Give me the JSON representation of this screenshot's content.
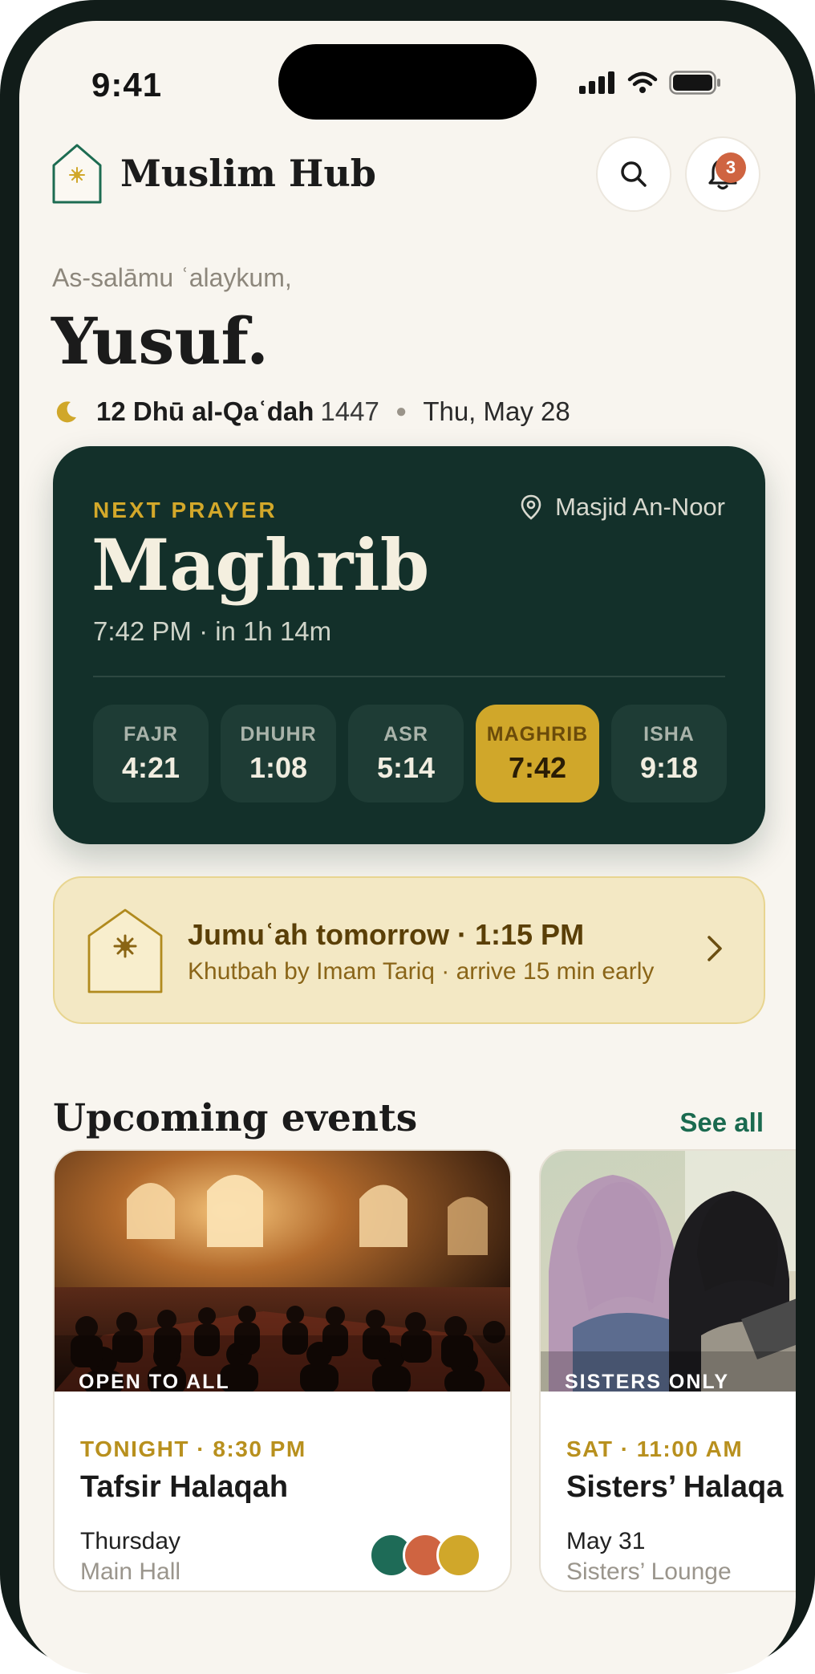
{
  "status_bar": {
    "time": "9:41"
  },
  "header": {
    "app_name": "Muslim Hub",
    "notification_count": "3"
  },
  "greeting": {
    "salutation": "As-salāmu ʿalaykum,",
    "name": "Yusuf."
  },
  "date": {
    "hijri_day_month": "12 Dhū al-Qaʿdah",
    "hijri_year": "1447",
    "gregorian": "Thu, May 28"
  },
  "next_prayer": {
    "label": "NEXT PRAYER",
    "location": "Masjid An-Noor",
    "name": "Maghrib",
    "time_info": "7:42 PM · in 1h 14m",
    "prayers": [
      {
        "label": "FAJR",
        "time": "4:21"
      },
      {
        "label": "DHUHR",
        "time": "1:08"
      },
      {
        "label": "ASR",
        "time": "5:14"
      },
      {
        "label": "MAGHRIB",
        "time": "7:42"
      },
      {
        "label": "ISHA",
        "time": "9:18"
      }
    ]
  },
  "jumuah": {
    "title": "Jumuʿah tomorrow · 1:15 PM",
    "subtitle": "Khutbah by Imam Tariq · arrive 15 min early"
  },
  "events_section": {
    "title": "Upcoming events",
    "see_all": "See all"
  },
  "events": [
    {
      "tag": "OPEN TO ALL",
      "when": "TONIGHT · 8:30 PM",
      "title": "Tafsir Halaqah",
      "day": "Thursday",
      "place": "Main Hall"
    },
    {
      "tag": "SISTERS ONLY",
      "when": "SAT · 11:00 AM",
      "title": "Sisters’ Halaqa",
      "day": "May 31",
      "place": "Sisters’ Lounge"
    }
  ],
  "colors": {
    "primary_dark": "#13302a",
    "accent_gold": "#d0a72a",
    "link_green": "#1a6a4f",
    "badge_orange": "#cf6441",
    "avatar_colors": [
      "#1e6b57",
      "#cf6441",
      "#d0a72a"
    ]
  }
}
